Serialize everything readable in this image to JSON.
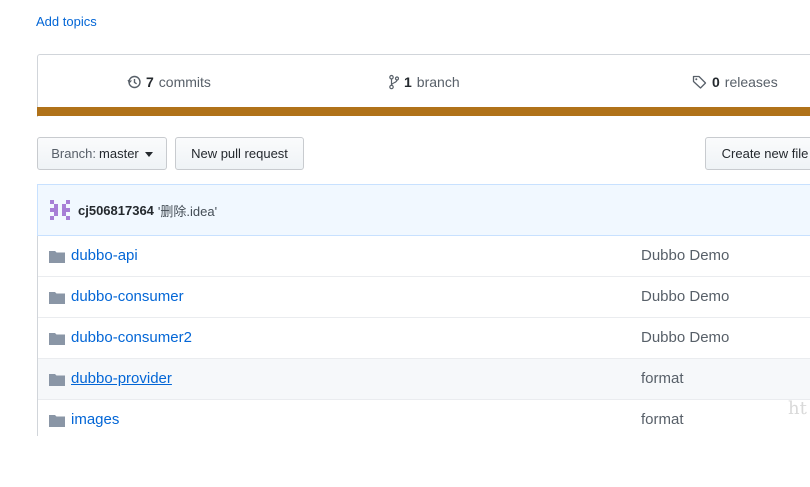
{
  "topics": {
    "add_label": "Add topics"
  },
  "summary": {
    "commits_count": "7",
    "commits_label": "commits",
    "branch_count": "1",
    "branch_label": "branch",
    "releases_count": "0",
    "releases_label": "releases",
    "language_color": "#b07219"
  },
  "toolbar": {
    "branch_prefix": "Branch:",
    "branch_value": "master",
    "new_pr_label": "New pull request",
    "create_file_label": "Create new file"
  },
  "latest_commit": {
    "author": "cj506817364",
    "message": "'删除.idea'"
  },
  "files": [
    {
      "name": "dubbo-api",
      "message": "Dubbo Demo"
    },
    {
      "name": "dubbo-consumer",
      "message": "Dubbo Demo"
    },
    {
      "name": "dubbo-consumer2",
      "message": "Dubbo Demo"
    },
    {
      "name": "dubbo-provider",
      "message": "format",
      "hovered": true
    },
    {
      "name": "images",
      "message": "format"
    }
  ],
  "watermark": "ht"
}
